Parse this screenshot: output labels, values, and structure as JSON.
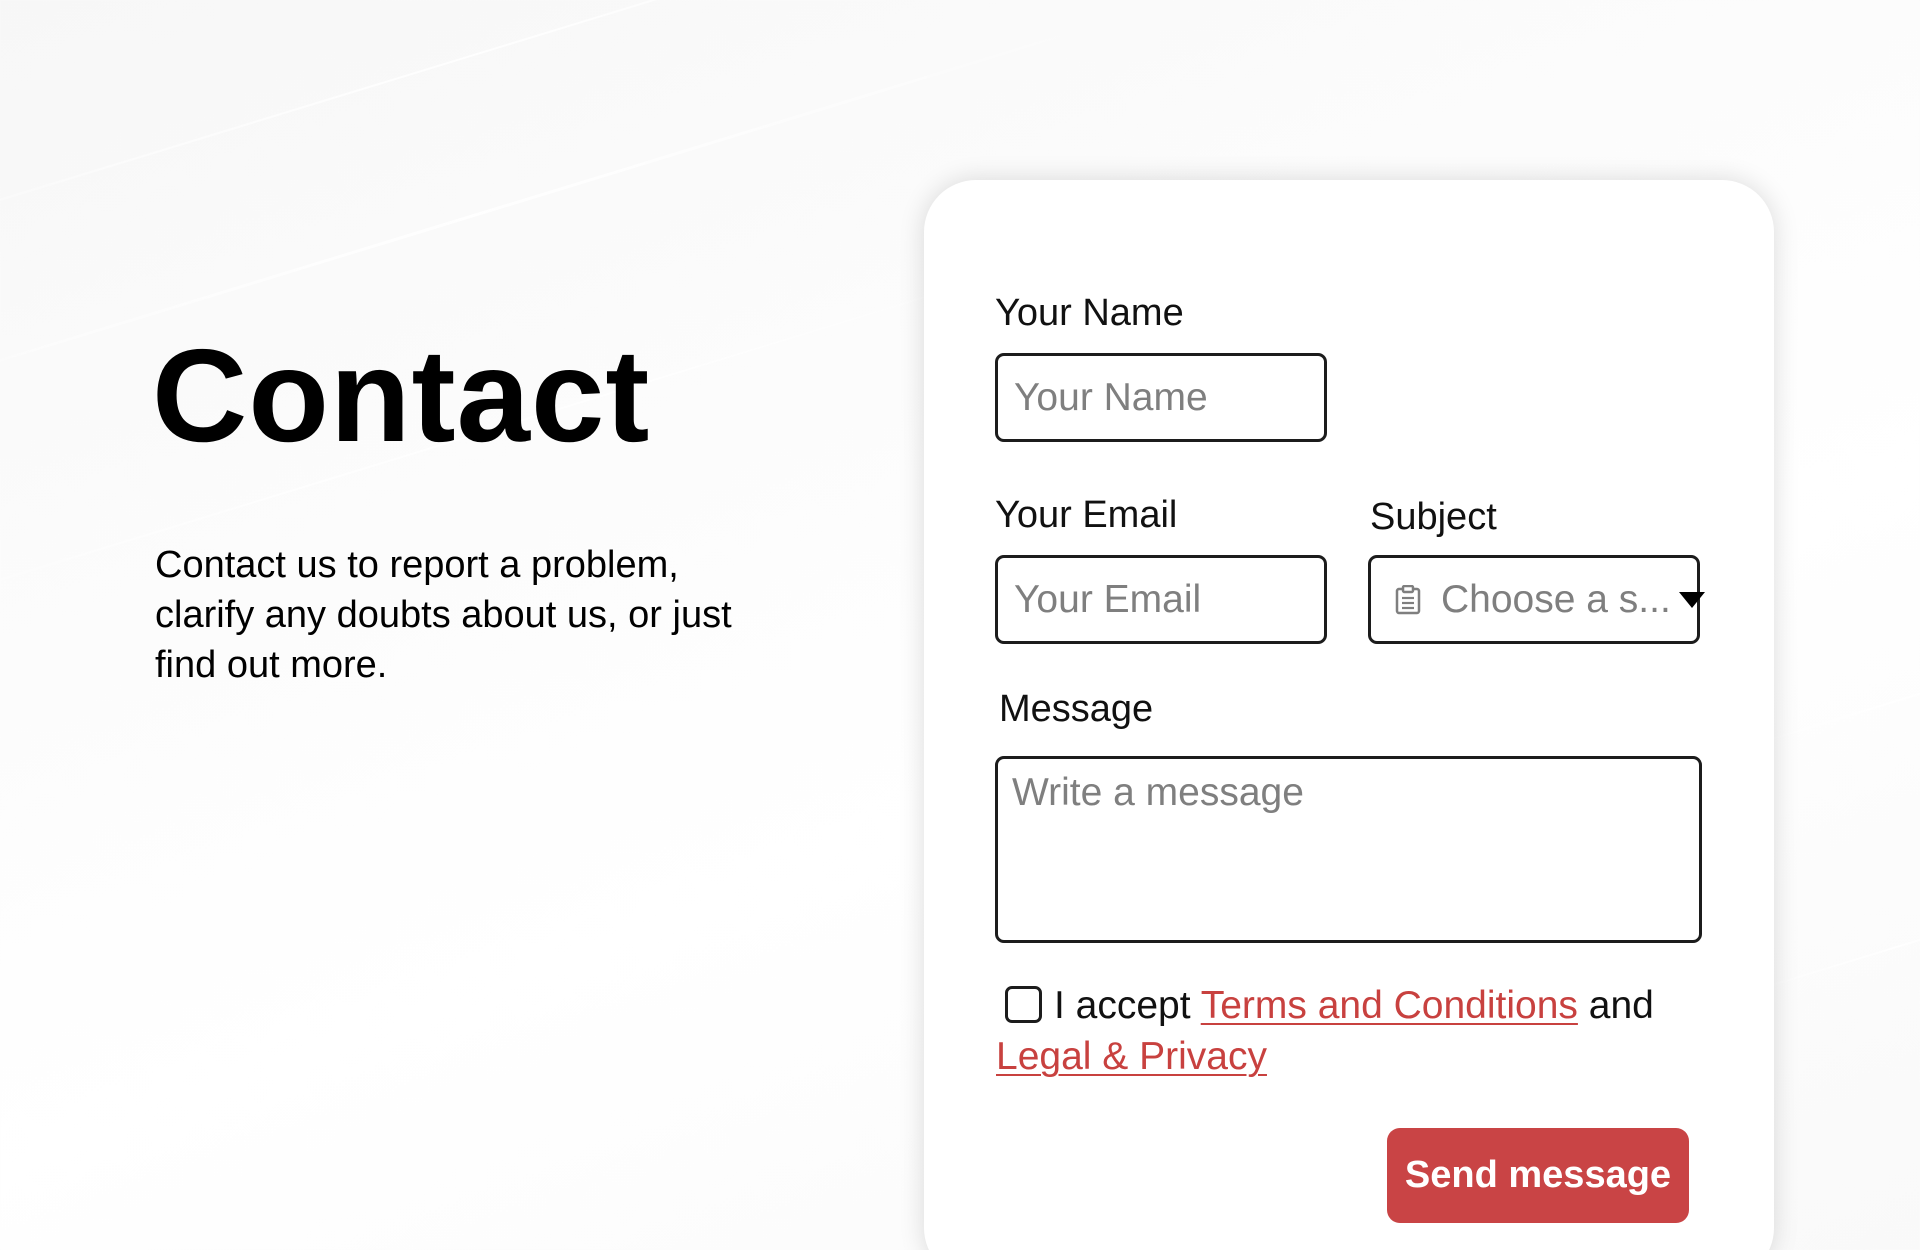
{
  "hero": {
    "title": "Contact",
    "description": "Contact us to report a problem, clarify any doubts about us, or just find out more."
  },
  "form": {
    "name": {
      "label": "Your Name",
      "placeholder": "Your Name"
    },
    "email": {
      "label": "Your Email",
      "placeholder": "Your Email"
    },
    "subject": {
      "label": "Subject",
      "placeholder": "Choose a s...",
      "icon": "clipboard-icon"
    },
    "message": {
      "label": "Message",
      "placeholder": "Write a message"
    },
    "consent": {
      "checked": false,
      "prefix": "I accept",
      "terms_link": "Terms and Conditions",
      "conjunction": "and",
      "privacy_link": "Legal & Privacy"
    },
    "submit_label": "Send message"
  },
  "colors": {
    "accent": "#c94445",
    "link": "#c8413f",
    "border": "#1c1c1c",
    "placeholder": "#7f7f7f"
  }
}
